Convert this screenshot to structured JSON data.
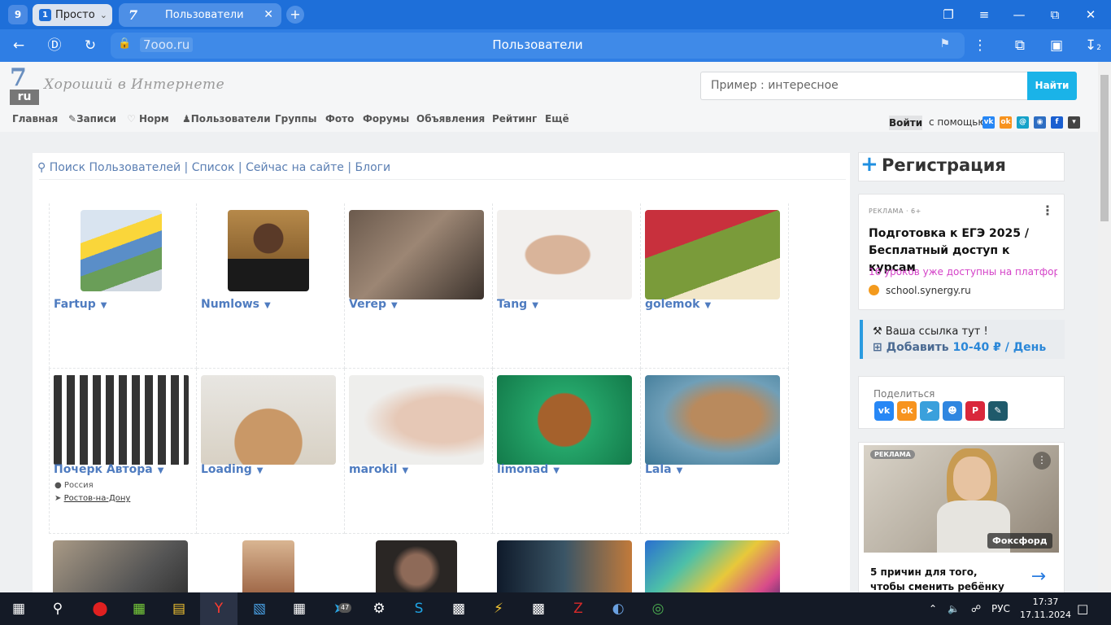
{
  "browser": {
    "tab_count": "9",
    "tab1": {
      "badge": "1",
      "label": "Просто"
    },
    "tab2": {
      "logo": "7",
      "label": "Пользователи"
    },
    "url_host": "7ooo.ru",
    "page_title": "Пользователи",
    "download_count": "2"
  },
  "site": {
    "logo_digit": "7",
    "logo_ru": "ru",
    "tagline": "Хороший в Интернете",
    "search_placeholder": "Пример : интересное",
    "search_button": "Найти",
    "menu": [
      "Главная",
      "Записи",
      "Норм",
      "Пользователи",
      "Группы",
      "Фото",
      "Форумы",
      "Объявления",
      "Рейтинг",
      "Ещё"
    ],
    "login": "Войти",
    "with_help": "с помощью:",
    "subnav": [
      "Поиск Пользователей",
      "Список",
      "Сейчас на сайте",
      "Блоги"
    ],
    "users": [
      {
        "name": "Fartup"
      },
      {
        "name": "Numlows"
      },
      {
        "name": "Verep"
      },
      {
        "name": "Tang"
      },
      {
        "name": "golemok"
      },
      {
        "name": "Почерк Автора",
        "country": "Россия",
        "city": "Ростов-на-Дону"
      },
      {
        "name": "Loading"
      },
      {
        "name": "marokil"
      },
      {
        "name": "limonad"
      },
      {
        "name": "Lala"
      }
    ]
  },
  "sidebar": {
    "register": "Регистрация",
    "ad1": {
      "label": "РЕКЛАМА · 6+",
      "headline": "Подготовка к ЕГЭ 2025 / Бесплатный доступ к курсам",
      "sub": "16 уроков уже доступны на платформ",
      "source": "school.synergy.ru"
    },
    "link_promo": {
      "line1": "Ваша ссылка тут !",
      "add": "Добавить",
      "price": "10-40 ₽",
      "per": "/ День"
    },
    "share_label": "Поделиться",
    "ad2": {
      "tag": "РЕКЛАМА",
      "brand": "Фоксфорд",
      "text": "5 причин для того, чтобы сменить ребёнку школу"
    }
  },
  "taskbar": {
    "telegram_badge": "47",
    "lang": "РУС",
    "time": "17:37",
    "date": "17.11.2024"
  }
}
